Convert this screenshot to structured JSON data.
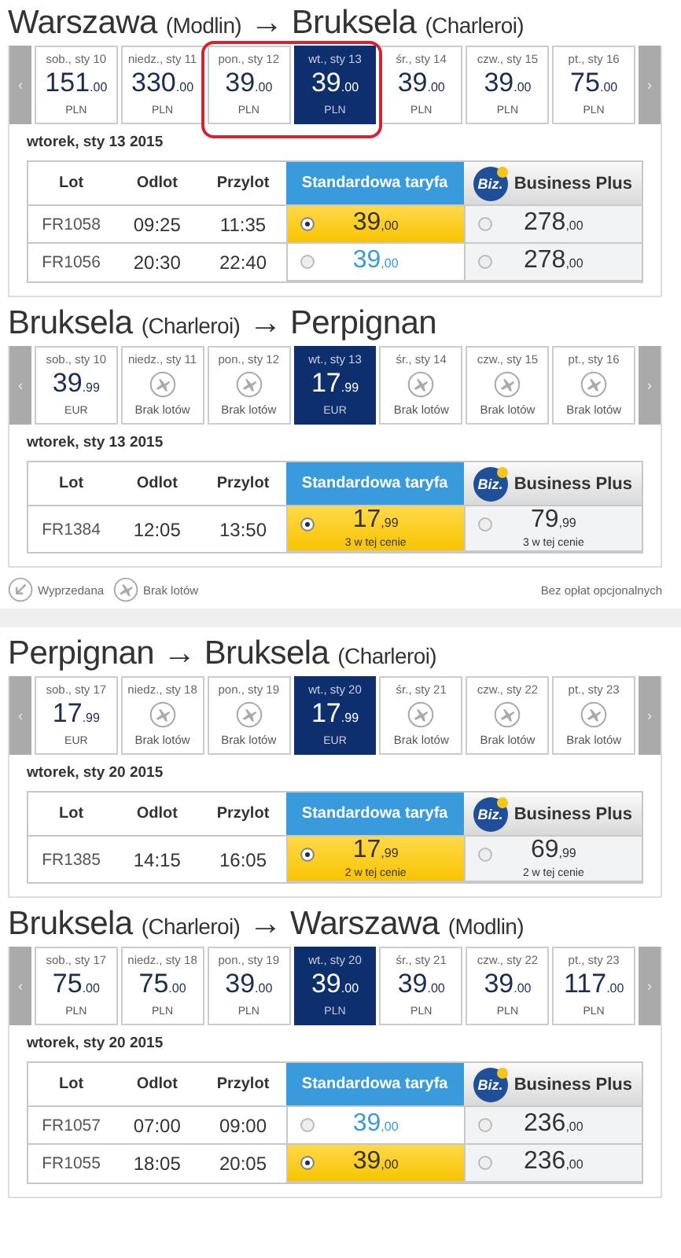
{
  "sections": [
    {
      "title": {
        "from": "Warszawa",
        "from_airport": "(Modlin)",
        "arrow": "→",
        "to": "Bruksela",
        "to_airport": "(Charleroi)"
      },
      "prev": "‹",
      "next": "›",
      "days": [
        {
          "label": "sob., sty 10",
          "kind": "price",
          "amount": "151",
          "cents": ".00",
          "currency": "PLN",
          "selected": false,
          "circled": false
        },
        {
          "label": "niedz., sty 11",
          "kind": "price",
          "amount": "330",
          "cents": ".00",
          "currency": "PLN",
          "selected": false,
          "circled": false
        },
        {
          "label": "pon., sty 12",
          "kind": "price",
          "amount": "39",
          "cents": ".00",
          "currency": "PLN",
          "selected": false,
          "circled": true
        },
        {
          "label": "wt., sty 13",
          "kind": "price",
          "amount": "39",
          "cents": ".00",
          "currency": "PLN",
          "selected": true,
          "circled": true
        },
        {
          "label": "śr., sty 14",
          "kind": "price",
          "amount": "39",
          "cents": ".00",
          "currency": "PLN",
          "selected": false,
          "circled": false
        },
        {
          "label": "czw., sty 15",
          "kind": "price",
          "amount": "39",
          "cents": ".00",
          "currency": "PLN",
          "selected": false,
          "circled": false
        },
        {
          "label": "pt., sty 16",
          "kind": "price",
          "amount": "75",
          "cents": ".00",
          "currency": "PLN",
          "selected": false,
          "circled": false
        }
      ],
      "date": "wtorek, sty 13 2015",
      "columns": [
        "Lot",
        "Odlot",
        "Przylot",
        "Standardowa taryfa",
        "Business Plus"
      ],
      "logo": "Biz.",
      "rows": [
        {
          "flight": "FR1058",
          "departure": "09:25",
          "arrival": "11:35",
          "standard": {
            "amount": "39",
            "cents": ",00",
            "selected": true
          },
          "business": {
            "amount": "278",
            "cents": ",00",
            "selected": false
          }
        },
        {
          "flight": "FR1056",
          "departure": "20:30",
          "arrival": "22:40",
          "standard": {
            "amount": "39",
            "cents": ",00",
            "selected": false
          },
          "business": {
            "amount": "278",
            "cents": ",00",
            "selected": false
          }
        }
      ]
    },
    {
      "title": {
        "from": "Bruksela",
        "from_airport": "(Charleroi)",
        "arrow": "→",
        "to": "Perpignan"
      },
      "prev": "‹",
      "next": "›",
      "days": [
        {
          "label": "sob., sty 10",
          "kind": "price",
          "amount": "39",
          "cents": ".99",
          "currency": "EUR",
          "selected": false
        },
        {
          "label": "niedz., sty 11",
          "kind": "none",
          "text": "Brak lotów",
          "selected": false
        },
        {
          "label": "pon., sty 12",
          "kind": "none",
          "text": "Brak lotów",
          "selected": false
        },
        {
          "label": "wt., sty 13",
          "kind": "price",
          "amount": "17",
          "cents": ".99",
          "currency": "EUR",
          "selected": true
        },
        {
          "label": "śr., sty 14",
          "kind": "none",
          "text": "Brak lotów",
          "selected": false
        },
        {
          "label": "czw., sty 15",
          "kind": "none",
          "text": "Brak lotów",
          "selected": false
        },
        {
          "label": "pt., sty 16",
          "kind": "none",
          "text": "Brak lotów",
          "selected": false
        }
      ],
      "date": "wtorek, sty 13 2015",
      "columns": [
        "Lot",
        "Odlot",
        "Przylot",
        "Standardowa taryfa",
        "Business Plus"
      ],
      "logo": "Biz.",
      "rows": [
        {
          "flight": "FR1384",
          "departure": "12:05",
          "arrival": "13:50",
          "standard": {
            "amount": "17",
            "cents": ",99",
            "note": "3 w tej cenie",
            "selected": true
          },
          "business": {
            "amount": "79",
            "cents": ",99",
            "note": "3 w tej cenie",
            "selected": false
          }
        }
      ],
      "legend": {
        "items": [
          {
            "kind": "sold_out",
            "label": "Wyprzedana"
          },
          {
            "kind": "no_flights",
            "label": "Brak lotów"
          }
        ],
        "note": "Bez opłat opcjonalnych"
      }
    },
    {
      "title": {
        "from": "Perpignan",
        "arrow": "→",
        "to": "Bruksela",
        "to_airport": "(Charleroi)"
      },
      "prev": "‹",
      "next": "›",
      "days": [
        {
          "label": "sob., sty 17",
          "kind": "price",
          "amount": "17",
          "cents": ".99",
          "currency": "EUR",
          "selected": false
        },
        {
          "label": "niedz., sty 18",
          "kind": "none",
          "text": "Brak lotów",
          "selected": false
        },
        {
          "label": "pon., sty 19",
          "kind": "none",
          "text": "Brak lotów",
          "selected": false
        },
        {
          "label": "wt., sty 20",
          "kind": "price",
          "amount": "17",
          "cents": ".99",
          "currency": "EUR",
          "selected": true
        },
        {
          "label": "śr., sty 21",
          "kind": "none",
          "text": "Brak lotów",
          "selected": false
        },
        {
          "label": "czw., sty 22",
          "kind": "none",
          "text": "Brak lotów",
          "selected": false
        },
        {
          "label": "pt., sty 23",
          "kind": "none",
          "text": "Brak lotów",
          "selected": false
        }
      ],
      "date": "wtorek, sty 20 2015",
      "columns": [
        "Lot",
        "Odlot",
        "Przylot",
        "Standardowa taryfa",
        "Business Plus"
      ],
      "logo": "Biz.",
      "rows": [
        {
          "flight": "FR1385",
          "departure": "14:15",
          "arrival": "16:05",
          "standard": {
            "amount": "17",
            "cents": ",99",
            "note": "2 w tej cenie",
            "selected": true
          },
          "business": {
            "amount": "69",
            "cents": ",99",
            "note": "2 w tej cenie",
            "selected": false
          }
        }
      ]
    },
    {
      "title": {
        "from": "Bruksela",
        "from_airport": "(Charleroi)",
        "arrow": "→",
        "to": "Warszawa",
        "to_airport": "(Modlin)"
      },
      "prev": "‹",
      "next": "›",
      "days": [
        {
          "label": "sob., sty 17",
          "kind": "price",
          "amount": "75",
          "cents": ".00",
          "currency": "PLN",
          "selected": false
        },
        {
          "label": "niedz., sty 18",
          "kind": "price",
          "amount": "75",
          "cents": ".00",
          "currency": "PLN",
          "selected": false
        },
        {
          "label": "pon., sty 19",
          "kind": "price",
          "amount": "39",
          "cents": ".00",
          "currency": "PLN",
          "selected": false
        },
        {
          "label": "wt., sty 20",
          "kind": "price",
          "amount": "39",
          "cents": ".00",
          "currency": "PLN",
          "selected": true
        },
        {
          "label": "śr., sty 21",
          "kind": "price",
          "amount": "39",
          "cents": ".00",
          "currency": "PLN",
          "selected": false
        },
        {
          "label": "czw., sty 22",
          "kind": "price",
          "amount": "39",
          "cents": ".00",
          "currency": "PLN",
          "selected": false
        },
        {
          "label": "pt., sty 23",
          "kind": "price",
          "amount": "117",
          "cents": ".00",
          "currency": "PLN",
          "selected": false
        }
      ],
      "date": "wtorek, sty 20 2015",
      "columns": [
        "Lot",
        "Odlot",
        "Przylot",
        "Standardowa taryfa",
        "Business Plus"
      ],
      "logo": "Biz.",
      "rows": [
        {
          "flight": "FR1057",
          "departure": "07:00",
          "arrival": "09:00",
          "standard": {
            "amount": "39",
            "cents": ",00",
            "selected": false
          },
          "business": {
            "amount": "236",
            "cents": ",00",
            "selected": false
          }
        },
        {
          "flight": "FR1055",
          "departure": "18:05",
          "arrival": "20:05",
          "standard": {
            "amount": "39",
            "cents": ",00",
            "selected": true
          },
          "business": {
            "amount": "236",
            "cents": ",00",
            "selected": false
          }
        }
      ]
    }
  ]
}
